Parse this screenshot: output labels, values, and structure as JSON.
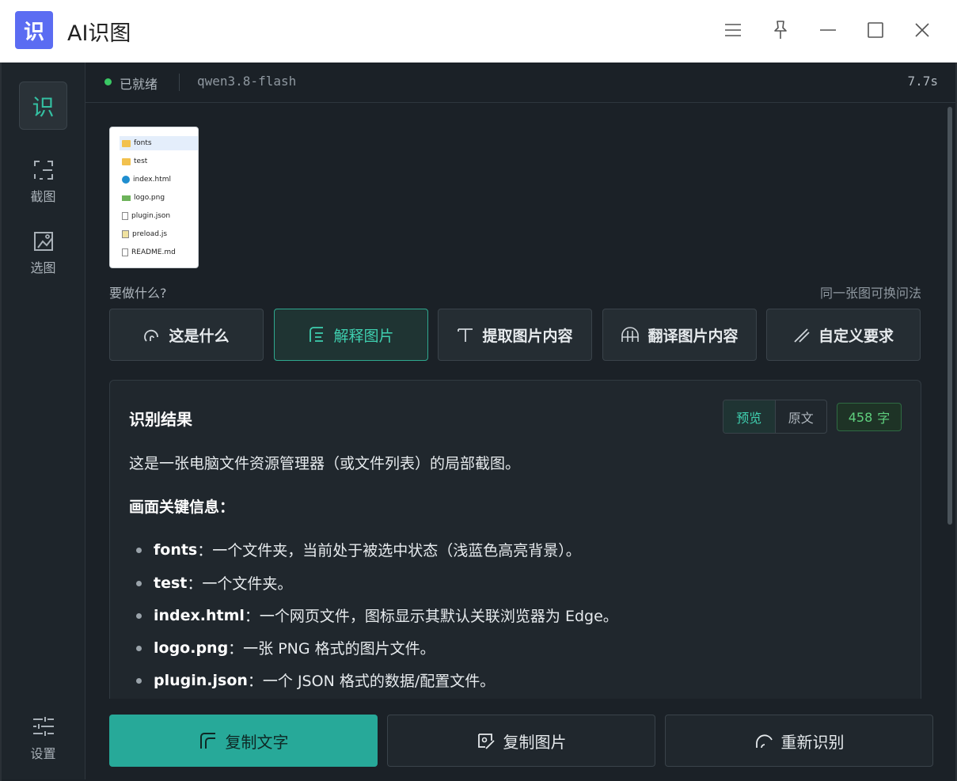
{
  "window": {
    "logo_text": "识",
    "title": "AI识图"
  },
  "sidebar": {
    "recognize_icon": "识",
    "items": [
      {
        "label": "截图",
        "icon": "crop-icon"
      },
      {
        "label": "选图",
        "icon": "image-pick-icon"
      }
    ],
    "settings_label": "设置"
  },
  "status": {
    "state": "已就绪",
    "model": "qwen3.8-flash",
    "elapsed": "7.7s",
    "dot_color": "#3ac864"
  },
  "thumbnail": {
    "files": [
      {
        "name": "fonts",
        "type": "folder",
        "selected": true
      },
      {
        "name": "test",
        "type": "folder"
      },
      {
        "name": "index.html",
        "type": "edge"
      },
      {
        "name": "logo.png",
        "type": "png"
      },
      {
        "name": "plugin.json",
        "type": "file"
      },
      {
        "name": "preload.js",
        "type": "js"
      },
      {
        "name": "README.md",
        "type": "file"
      }
    ]
  },
  "prompt": {
    "label": "要做什么?",
    "hint": "同一张图可换问法",
    "actions": [
      {
        "label": "这是什么",
        "icon": "question-icon"
      },
      {
        "label": "解释图片",
        "icon": "explain-icon",
        "active": true
      },
      {
        "label": "提取图片内容",
        "icon": "text-icon"
      },
      {
        "label": "翻译图片内容",
        "icon": "translate-icon"
      },
      {
        "label": "自定义要求",
        "icon": "pen-icon"
      }
    ]
  },
  "result": {
    "title": "识别结果",
    "tab_preview": "预览",
    "tab_raw": "原文",
    "count": "458",
    "count_unit": "字",
    "intro": "这是一张电脑文件资源管理器（或文件列表）的局部截图。",
    "key_heading": "画面关键信息：",
    "bullets": [
      {
        "name": "fonts",
        "text": "：一个文件夹，当前处于被选中状态（浅蓝色高亮背景）。"
      },
      {
        "name": "test",
        "text": "：一个文件夹。"
      },
      {
        "name": "index.html",
        "text": "：一个网页文件，图标显示其默认关联浏览器为 Edge。"
      },
      {
        "name": "logo.png",
        "text": "：一张 PNG 格式的图片文件。"
      },
      {
        "name": "plugin.json",
        "text": "：一个 JSON 格式的数据/配置文件。"
      }
    ]
  },
  "bottom": {
    "copy_text": "复制文字",
    "copy_image": "复制图片",
    "reidentify": "重新识别"
  },
  "colors": {
    "accent": "#27a999",
    "brand": "#5b6cf2",
    "background": "#1b2127"
  }
}
